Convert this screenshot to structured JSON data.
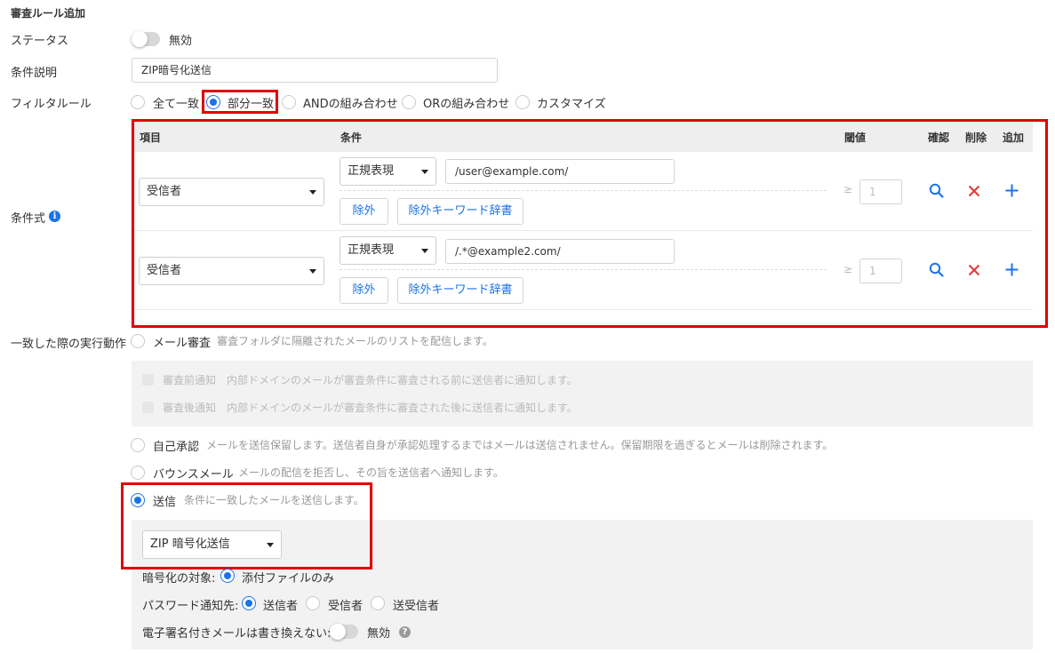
{
  "page_title": "審査ルール追加",
  "status": {
    "label": "ステータス",
    "toggle_text": "無効"
  },
  "description": {
    "label": "条件説明",
    "value": "ZIP暗号化送信"
  },
  "filter_rule": {
    "label": "フィルタルール",
    "options": [
      "全て一致",
      "部分一致",
      "ANDの組み合わせ",
      "ORの組み合わせ",
      "カスタマイズ"
    ],
    "selected": "部分一致"
  },
  "conditions": {
    "label": "条件式",
    "headers": {
      "item": "項目",
      "condition": "条件",
      "threshold": "閾値",
      "confirm": "確認",
      "delete": "削除",
      "add": "追加"
    },
    "rows": [
      {
        "item": "受信者",
        "match_type": "正規表現",
        "value": "/user@example.com/",
        "exclude_button": "除外",
        "dict_button": "除外キーワード辞書",
        "ge": "≥",
        "threshold_placeholder": "1"
      },
      {
        "item": "受信者",
        "match_type": "正規表現",
        "value": "/.*@example2.com/",
        "exclude_button": "除外",
        "dict_button": "除外キーワード辞書",
        "ge": "≥",
        "threshold_placeholder": "1"
      }
    ]
  },
  "actions": {
    "label": "一致した際の実行動作",
    "mail_review": {
      "label": "メール審査",
      "desc": "審査フォルダに隔離されたメールのリストを配信します。"
    },
    "pre_notify": {
      "label": "審査前通知",
      "desc": "内部ドメインのメールが審査条件に審査される前に送信者に通知します。"
    },
    "post_notify": {
      "label": "審査後通知",
      "desc": "内部ドメインのメールが審査条件に審査された後に送信者に通知します。"
    },
    "self_approval": {
      "label": "自己承認",
      "desc": "メールを送信保留します。送信者自身が承認処理するまではメールは送信されません。保留期限を過ぎるとメールは削除されます。"
    },
    "bounce": {
      "label": "バウンスメール",
      "desc": "メールの配信を拒否し、その旨を送信者へ通知します。"
    },
    "send": {
      "label": "送信",
      "desc": "条件に一致したメールを送信します。"
    },
    "selected": "送信"
  },
  "send_options": {
    "encryption_select": "ZIP 暗号化送信",
    "target_label": "暗号化の対象:",
    "target_option": "添付ファイルのみ",
    "password_label": "パスワード通知先:",
    "password_options": [
      "送信者",
      "受信者",
      "送受信者"
    ],
    "password_selected": "送信者",
    "signed_label": "電子署名付きメールは書き換えない:",
    "signed_toggle_text": "無効"
  },
  "colors": {
    "accent": "#1a73e8",
    "highlight": "#e00000",
    "delete": "#e53935"
  }
}
